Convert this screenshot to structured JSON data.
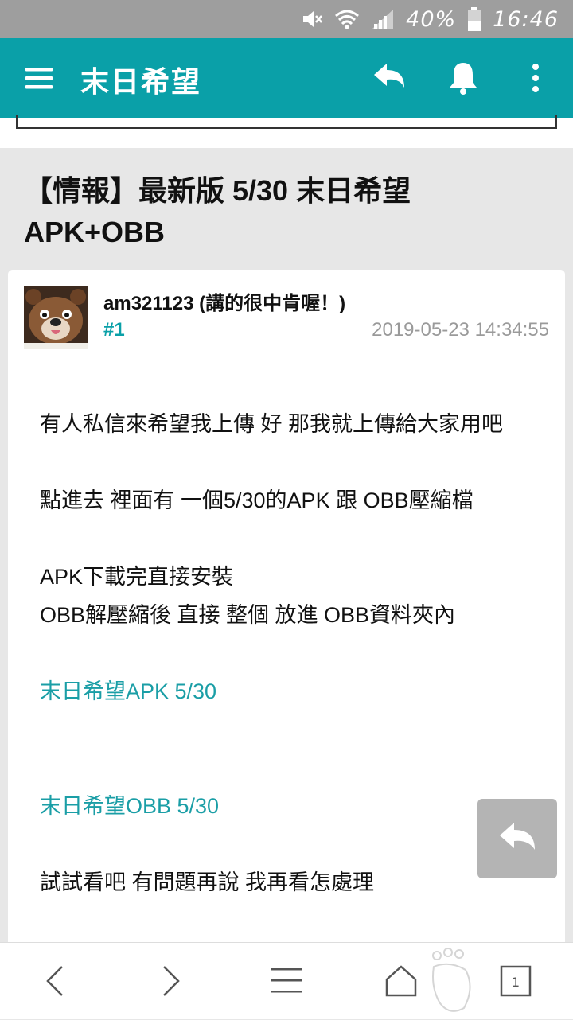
{
  "status_bar": {
    "battery": "40%",
    "time": "16:46",
    "icons": [
      "mute-icon",
      "wifi-icon",
      "signal-icon",
      "battery-icon"
    ]
  },
  "app_bar": {
    "title": "末日希望",
    "icons": [
      "menu-icon",
      "reply-icon",
      "bell-icon",
      "more-icon"
    ]
  },
  "thread": {
    "title": "【情報】最新版 5/30 末日希望 APK+OBB"
  },
  "post": {
    "author": "am321123 (講的很中肯喔！)",
    "floor": "#1",
    "date": "2019-05-23 14:34:55",
    "lines": [
      "有人私信來希望我上傳  好 那我就上傳給大家用吧",
      "點進去 裡面有 一個5/30的APK 跟 OBB壓縮檔",
      "APK下載完直接安裝",
      "OBB解壓縮後 直接 整個 放進 OBB資料夾內",
      "試試看吧  有問題再說  我再看怎處理"
    ],
    "links": [
      "末日希望APK 5/30",
      "末日希望OBB 5/30"
    ]
  },
  "colors": {
    "accent": "#0aa0a8",
    "status_bar": "#9e9e9e",
    "link": "#1a9ea6",
    "date": "#9a9a9a",
    "fab": "#b4b4b4"
  },
  "bottom_nav": {
    "icons": [
      "back-icon",
      "forward-icon",
      "menu-lines-icon",
      "home-icon",
      "tabs-icon"
    ],
    "tab_count": "1"
  }
}
